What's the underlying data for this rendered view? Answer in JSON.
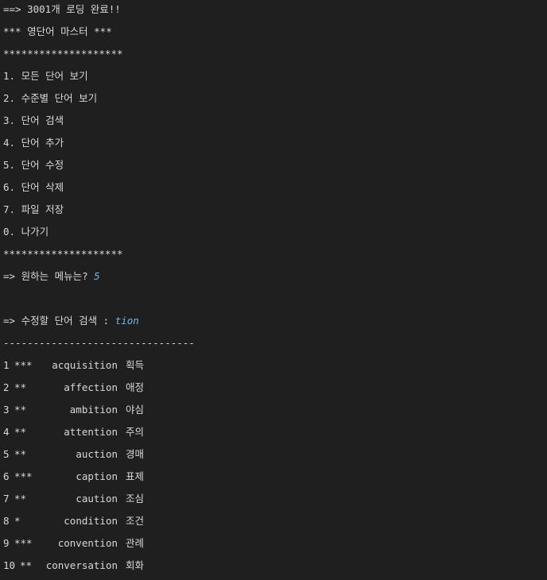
{
  "header": {
    "loading_msg": "==> 3001개 로딩 완료!!",
    "title": "*** 영단어 마스터 ***",
    "divider": "********************"
  },
  "menu": {
    "items": [
      "1. 모든 단어 보기",
      "2. 수준별 단어 보기",
      "3. 단어 검색",
      "4. 단어 추가",
      "5. 단어 수정",
      "6. 단어 삭제",
      "7. 파일 저장",
      "0. 나가기"
    ],
    "divider_bottom": "********************",
    "prompt": "=> 원하는 메뉴는? ",
    "input_value": "5"
  },
  "search": {
    "prompt": "=> 수정할 단어 검색 : ",
    "input_value": "tion",
    "separator": "--------------------------------"
  },
  "results": [
    {
      "no": "1",
      "stars": "***",
      "word": "acquisition",
      "meaning": "획득"
    },
    {
      "no": "2",
      "stars": "**",
      "word": "affection",
      "meaning": "애정"
    },
    {
      "no": "3",
      "stars": "**",
      "word": "ambition",
      "meaning": "야심"
    },
    {
      "no": "4",
      "stars": "**",
      "word": "attention",
      "meaning": "주의"
    },
    {
      "no": "5",
      "stars": "**",
      "word": "auction",
      "meaning": "경매"
    },
    {
      "no": "6",
      "stars": "***",
      "word": "caption",
      "meaning": "표제"
    },
    {
      "no": "7",
      "stars": "**",
      "word": "caution",
      "meaning": "조심"
    },
    {
      "no": "8",
      "stars": "*",
      "word": "condition",
      "meaning": "조건"
    },
    {
      "no": "9",
      "stars": "***",
      "word": "convention",
      "meaning": "관례"
    },
    {
      "no": "10",
      "stars": "**",
      "word": "conversation",
      "meaning": "회화"
    }
  ],
  "colors": {
    "background": "#1f1f1f",
    "text": "#d8d8d8",
    "user_input": "#6fb7e8"
  }
}
